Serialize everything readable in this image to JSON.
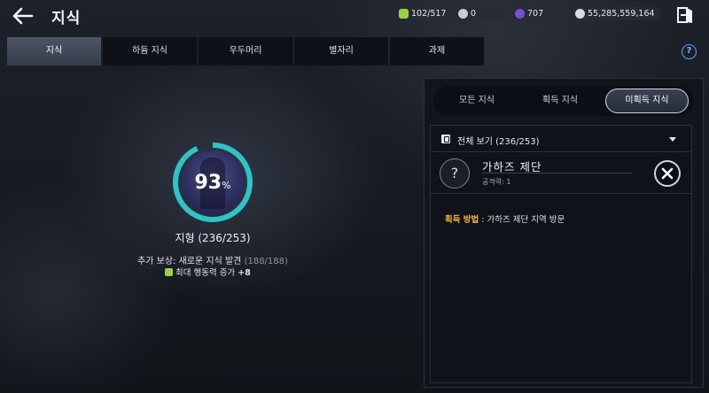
{
  "header": {
    "title": "지식",
    "resources": [
      {
        "name": "action-points",
        "value": "102/517",
        "color": "#9bd24a"
      },
      {
        "name": "silver-coin",
        "value": "0",
        "color": "#c8ccd4"
      },
      {
        "name": "purple-gem",
        "value": "707",
        "color": "#7a4fd6"
      },
      {
        "name": "silver",
        "value": "55,285,559,164",
        "color": "#d7dbe3"
      }
    ]
  },
  "tabs": [
    {
      "label": "지식",
      "active": true
    },
    {
      "label": "하듐 지식",
      "active": false
    },
    {
      "label": "우두머리",
      "active": false
    },
    {
      "label": "별자리",
      "active": false
    },
    {
      "label": "과제",
      "active": false
    }
  ],
  "help_label": "?",
  "progress": {
    "percent": "93",
    "percent_unit": "%",
    "fraction": 0.93,
    "category_label": "지형 (236/253)",
    "reward_label": "추가 보상: 새로운 지식 발견",
    "reward_count": "(188/188)",
    "bonus_label": "최대 행동력 증가",
    "bonus_value": "+8"
  },
  "panel": {
    "segments": [
      {
        "label": "모든 지식",
        "active": false
      },
      {
        "label": "획득 지식",
        "active": false
      },
      {
        "label": "미획득 지식",
        "active": true
      }
    ],
    "filter_label": "전체 보기 (236/253)",
    "item": {
      "icon_label": "?",
      "title": "가하즈 제단",
      "subtitle": "공격력: 1"
    },
    "acquire_key": "획득 방법",
    "acquire_value": " : 가하즈 제단 지역 방문"
  },
  "colors": {
    "accent_blue": "#5aa0ff",
    "ring_teal": "#2fc3c8",
    "highlight_orange": "#f2b442"
  }
}
